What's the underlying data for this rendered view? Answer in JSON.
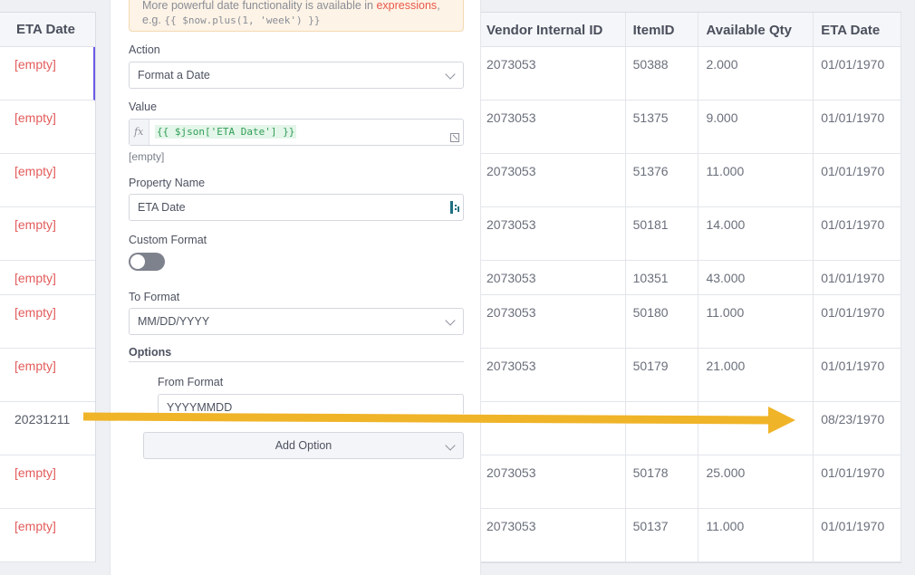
{
  "input_table": {
    "column": "ETA Date",
    "rows": [
      "[empty]",
      "[empty]",
      "[empty]",
      "[empty]",
      "[empty]",
      "[empty]",
      "[empty]",
      "20231211",
      "[empty]",
      "[empty]"
    ]
  },
  "panel": {
    "notice_text": "More powerful date functionality is available in ",
    "notice_link": "expressions",
    "notice_comma": ",",
    "notice_example_prefix": "e.g. ",
    "notice_example_code": "{{ $now.plus(1, 'week') }}",
    "action_label": "Action",
    "action_value": "Format a Date",
    "value_label": "Value",
    "value_fx": "fx",
    "value_expression": "{{ $json['ETA Date'] }}",
    "value_result": "[empty]",
    "property_label": "Property Name",
    "property_value": "ETA Date",
    "custom_format_label": "Custom Format",
    "to_format_label": "To Format",
    "to_format_value": "MM/DD/YYYY",
    "options_label": "Options",
    "from_format_label": "From Format",
    "from_format_value": "YYYYMMDD",
    "add_option_label": "Add Option"
  },
  "output_table": {
    "headers": [
      "Vendor Internal ID",
      "ItemID",
      "Available Qty",
      "ETA Date"
    ],
    "rows": [
      [
        "2073053",
        "50388",
        "2.000",
        "01/01/1970"
      ],
      [
        "2073053",
        "51375",
        "9.000",
        "01/01/1970"
      ],
      [
        "2073053",
        "51376",
        "11.000",
        "01/01/1970"
      ],
      [
        "2073053",
        "50181",
        "14.000",
        "01/01/1970"
      ],
      [
        "2073053",
        "10351",
        "43.000",
        "01/01/1970"
      ],
      [
        "2073053",
        "50180",
        "11.000",
        "01/01/1970"
      ],
      [
        "2073053",
        "50179",
        "21.000",
        "01/01/1970"
      ],
      [
        "",
        "",
        "",
        "08/23/1970"
      ],
      [
        "2073053",
        "50178",
        "25.000",
        "01/01/1970"
      ],
      [
        "2073053",
        "50137",
        "11.000",
        "01/01/1970"
      ]
    ]
  },
  "colors": {
    "empty_red": "#e35b5b",
    "arrow_yellow": "#f0b429",
    "accent_purple": "#6b5be6"
  }
}
